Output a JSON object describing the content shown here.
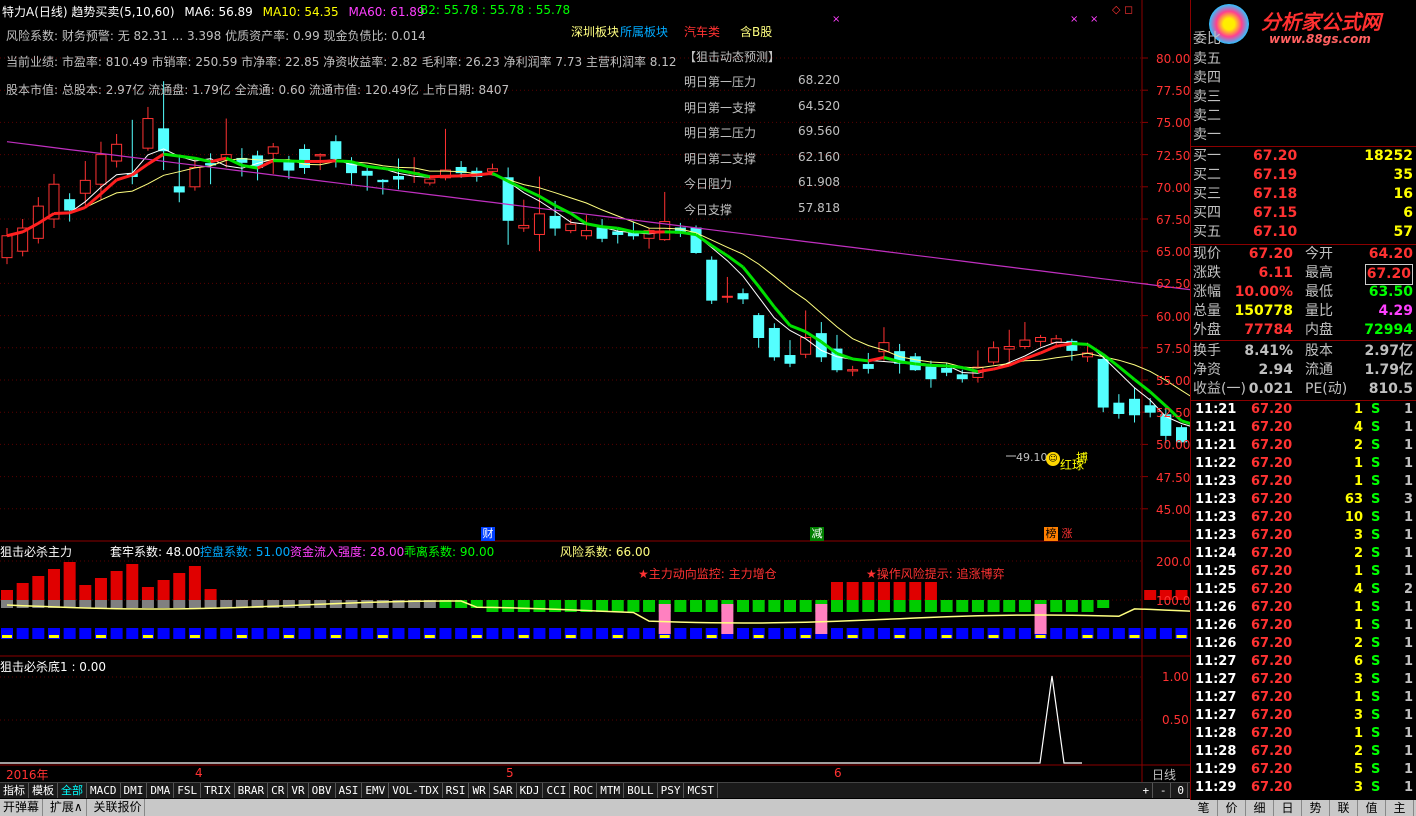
{
  "header": {
    "title": "特力A(日线) 趋势买卖(5,10,60)",
    "ma6": "MA6: 56.89",
    "ma10": "MA10: 54.35",
    "ma60": "MA60: 61.89",
    "b2_label": "B2: 55.78 : 55.78 : 55.78"
  },
  "info_lines": [
    "风险系数: 财务预警: 无 82.31 ... 3.398 优质资产率: 0.99 现金负债比: 0.014",
    "当前业绩: 市盈率: 810.49 市销率: 250.59 市净率: 22.85 净资收益率: 2.82 毛利率: 26.23 净利润率 7.73 主营利润率 8.12",
    "股本市值: 总股本: 2.97亿 流通盘: 1.79亿 全流通: 0.60 流通市值: 120.49亿 上市日期: 8407"
  ],
  "sectors": {
    "s1": "深圳板块",
    "s2": "所属板块",
    "s3": "汽车类",
    "s4": "含B股"
  },
  "prediction": {
    "title": "【狙击动态预测】",
    "rows": [
      {
        "label": "明日第一压力",
        "value": "68.220"
      },
      {
        "label": "明日第一支撑",
        "value": "64.520"
      },
      {
        "label": "明日第二压力",
        "value": "69.560"
      },
      {
        "label": "明日第二支撑",
        "value": "62.160"
      },
      {
        "label": "今日阻力",
        "value": "61.908"
      },
      {
        "label": "今日支撑",
        "value": "57.818"
      }
    ]
  },
  "price_axis": [
    "80.00",
    "77.50",
    "75.00",
    "72.50",
    "70.00",
    "67.50",
    "65.00",
    "62.50",
    "60.00",
    "57.50",
    "55.00",
    "52.50",
    "50.00",
    "47.50",
    "45.00"
  ],
  "low_marker": "49.10",
  "badges": {
    "cai": "财",
    "jian": "减",
    "bang": "榜",
    "zhang": "涨",
    "bo": "搏",
    "hongqiu": "红球"
  },
  "panel2": {
    "title": "狙击必杀主力",
    "taolao": "套牢系数: 48.00",
    "kongpan": "控盘系数: 51.00",
    "zijin": "资金流入强度: 28.00",
    "guaili": "乖离系数: 90.00",
    "fengxian": "风险系数: 66.00",
    "monitor": "★主力动向监控: 主力增仓",
    "risk_tip": "★操作风险提示: 追涨博弈",
    "axis": [
      "200.0",
      "100.0"
    ]
  },
  "panel3": {
    "title": "狙击必杀底1 : 0.00",
    "axis": [
      "1.00",
      "0.50"
    ]
  },
  "time_axis": {
    "year": "2016年",
    "m4": "4",
    "m5": "5",
    "m6": "6",
    "period": "日线"
  },
  "tabs": [
    "指标",
    "模板",
    "全部",
    "MACD",
    "DMI",
    "DMA",
    "FSL",
    "TRIX",
    "BRAR",
    "CR",
    "VR",
    "OBV",
    "ASI",
    "EMV",
    "VOL-TDX",
    "RSI",
    "WR",
    "SAR",
    "KDJ",
    "CCI",
    "ROC",
    "MTM",
    "BOLL",
    "PSY",
    "MCST"
  ],
  "tab_controls": [
    "+",
    "-",
    "0"
  ],
  "bottom_buttons": [
    "开弹幕",
    "扩展∧",
    "关联报价"
  ],
  "logo": {
    "name": "分析家公式网",
    "url": "www.88gs.com"
  },
  "orderbook": {
    "wei": "委比",
    "sells": [
      "卖五",
      "卖四",
      "卖三",
      "卖二",
      "卖一"
    ],
    "buys": [
      {
        "label": "买一",
        "price": "67.20",
        "vol": "18252"
      },
      {
        "label": "买二",
        "price": "67.19",
        "vol": "35"
      },
      {
        "label": "买三",
        "price": "67.18",
        "vol": "16"
      },
      {
        "label": "买四",
        "price": "67.15",
        "vol": "6"
      },
      {
        "label": "买五",
        "price": "67.10",
        "vol": "57"
      }
    ]
  },
  "quote": [
    {
      "l1": "现价",
      "v1": "67.20",
      "l2": "今开",
      "v2": "64.20"
    },
    {
      "l1": "涨跌",
      "v1": "6.11",
      "l2": "最高",
      "v2": "67.20"
    },
    {
      "l1": "涨幅",
      "v1": "10.00%",
      "l2": "最低",
      "v2": "63.50"
    },
    {
      "l1": "总量",
      "v1": "150778",
      "l2": "量比",
      "v2": "4.29"
    },
    {
      "l1": "外盘",
      "v1": "77784",
      "l2": "内盘",
      "v2": "72994"
    },
    {
      "l1": "换手",
      "v1": "8.41%",
      "l2": "股本",
      "v2": "2.97亿"
    },
    {
      "l1": "净资",
      "v1": "2.94",
      "l2": "流通",
      "v2": "1.79亿"
    },
    {
      "l1": "收益(一)",
      "v1": "0.021",
      "l2": "PE(动)",
      "v2": "810.5"
    }
  ],
  "ticks": [
    {
      "t": "11:21",
      "p": "67.20",
      "v": "1",
      "s": "S",
      "n": "1"
    },
    {
      "t": "11:21",
      "p": "67.20",
      "v": "4",
      "s": "S",
      "n": "1"
    },
    {
      "t": "11:21",
      "p": "67.20",
      "v": "2",
      "s": "S",
      "n": "1"
    },
    {
      "t": "11:22",
      "p": "67.20",
      "v": "1",
      "s": "S",
      "n": "1"
    },
    {
      "t": "11:23",
      "p": "67.20",
      "v": "1",
      "s": "S",
      "n": "1"
    },
    {
      "t": "11:23",
      "p": "67.20",
      "v": "63",
      "s": "S",
      "n": "3"
    },
    {
      "t": "11:23",
      "p": "67.20",
      "v": "10",
      "s": "S",
      "n": "1"
    },
    {
      "t": "11:23",
      "p": "67.20",
      "v": "3",
      "s": "S",
      "n": "1"
    },
    {
      "t": "11:24",
      "p": "67.20",
      "v": "2",
      "s": "S",
      "n": "1"
    },
    {
      "t": "11:25",
      "p": "67.20",
      "v": "1",
      "s": "S",
      "n": "1"
    },
    {
      "t": "11:25",
      "p": "67.20",
      "v": "4",
      "s": "S",
      "n": "2"
    },
    {
      "t": "11:26",
      "p": "67.20",
      "v": "1",
      "s": "S",
      "n": "1"
    },
    {
      "t": "11:26",
      "p": "67.20",
      "v": "1",
      "s": "S",
      "n": "1"
    },
    {
      "t": "11:26",
      "p": "67.20",
      "v": "2",
      "s": "S",
      "n": "1"
    },
    {
      "t": "11:27",
      "p": "67.20",
      "v": "6",
      "s": "S",
      "n": "1"
    },
    {
      "t": "11:27",
      "p": "67.20",
      "v": "3",
      "s": "S",
      "n": "1"
    },
    {
      "t": "11:27",
      "p": "67.20",
      "v": "1",
      "s": "S",
      "n": "1"
    },
    {
      "t": "11:27",
      "p": "67.20",
      "v": "3",
      "s": "S",
      "n": "1"
    },
    {
      "t": "11:28",
      "p": "67.20",
      "v": "1",
      "s": "S",
      "n": "1"
    },
    {
      "t": "11:28",
      "p": "67.20",
      "v": "2",
      "s": "S",
      "n": "1"
    },
    {
      "t": "11:29",
      "p": "67.20",
      "v": "5",
      "s": "S",
      "n": "1"
    },
    {
      "t": "11:29",
      "p": "67.20",
      "v": "3",
      "s": "S",
      "n": "1"
    }
  ],
  "rp_tabs": [
    "笔",
    "价",
    "细",
    "日",
    "势",
    "联",
    "值",
    "主"
  ],
  "colors": {
    "up": "#ff3232",
    "down": "#54ffff",
    "green_line": "#00e000",
    "ma60": "#c030c0"
  }
}
